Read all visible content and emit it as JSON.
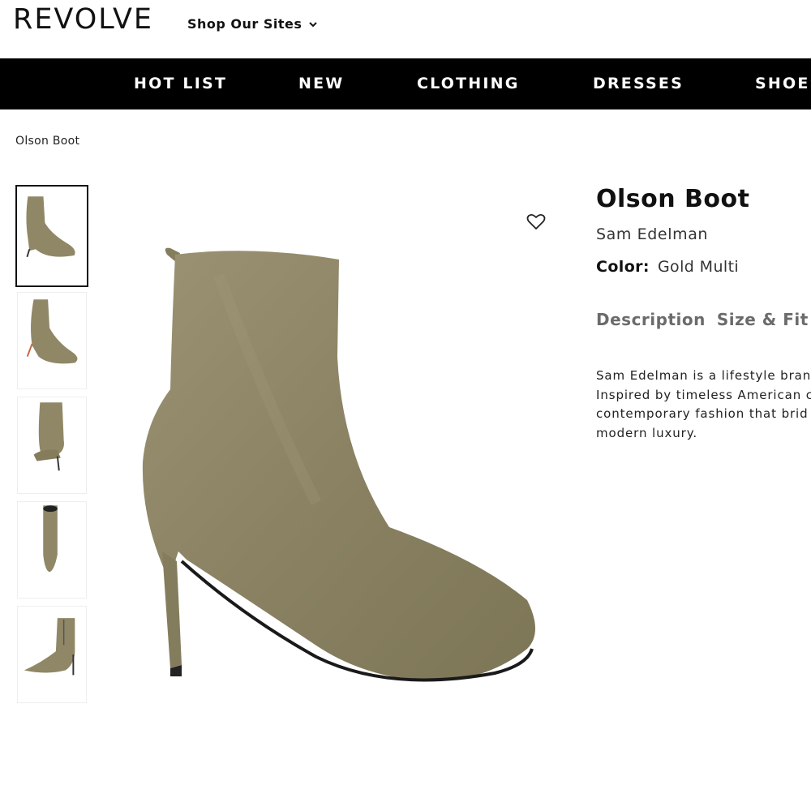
{
  "header": {
    "logo": "REVOLVE",
    "shop_sites": "Shop Our Sites"
  },
  "nav": {
    "items": [
      "HOT LIST",
      "NEW",
      "CLOTHING",
      "DRESSES",
      "SHOES"
    ]
  },
  "breadcrumb": "Olson Boot",
  "product": {
    "title": "Olson Boot",
    "brand": "Sam Edelman",
    "color_label": "Color:",
    "color_value": "Gold Multi",
    "tabs": [
      "Description",
      "Size & Fit"
    ],
    "description_lines": [
      "Sam Edelman is a lifestyle brand",
      "Inspired by timeless American c",
      "contemporary fashion that brid",
      "modern luxury."
    ]
  },
  "thumbnails": [
    {
      "view": "side",
      "active": true
    },
    {
      "view": "side-angle",
      "active": false
    },
    {
      "view": "back",
      "active": false
    },
    {
      "view": "front",
      "active": false
    },
    {
      "view": "inner-zip",
      "active": false
    }
  ],
  "colors": {
    "nav_bg": "#000000",
    "nav_text": "#ffffff",
    "tab_text": "#6b6b6b",
    "boot_gold": "#8f8766"
  },
  "icons": {
    "wishlist": "heart-outline-icon",
    "shop_sites_chevron": "chevron-down-icon"
  }
}
